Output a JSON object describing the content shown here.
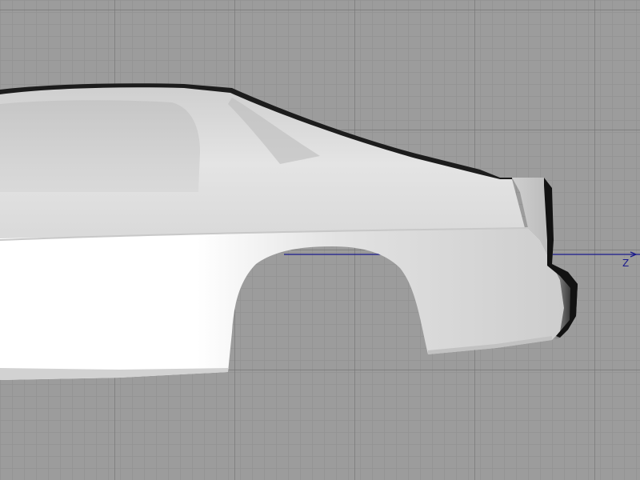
{
  "viewport": {
    "axis_label": "Z"
  },
  "colors": {
    "background": "#9c9c9c",
    "grid_minor": "#8e8e8e",
    "grid_major": "#6f6f6f",
    "axis": "#1a1a8c",
    "model_body": "#e6e6e6"
  }
}
